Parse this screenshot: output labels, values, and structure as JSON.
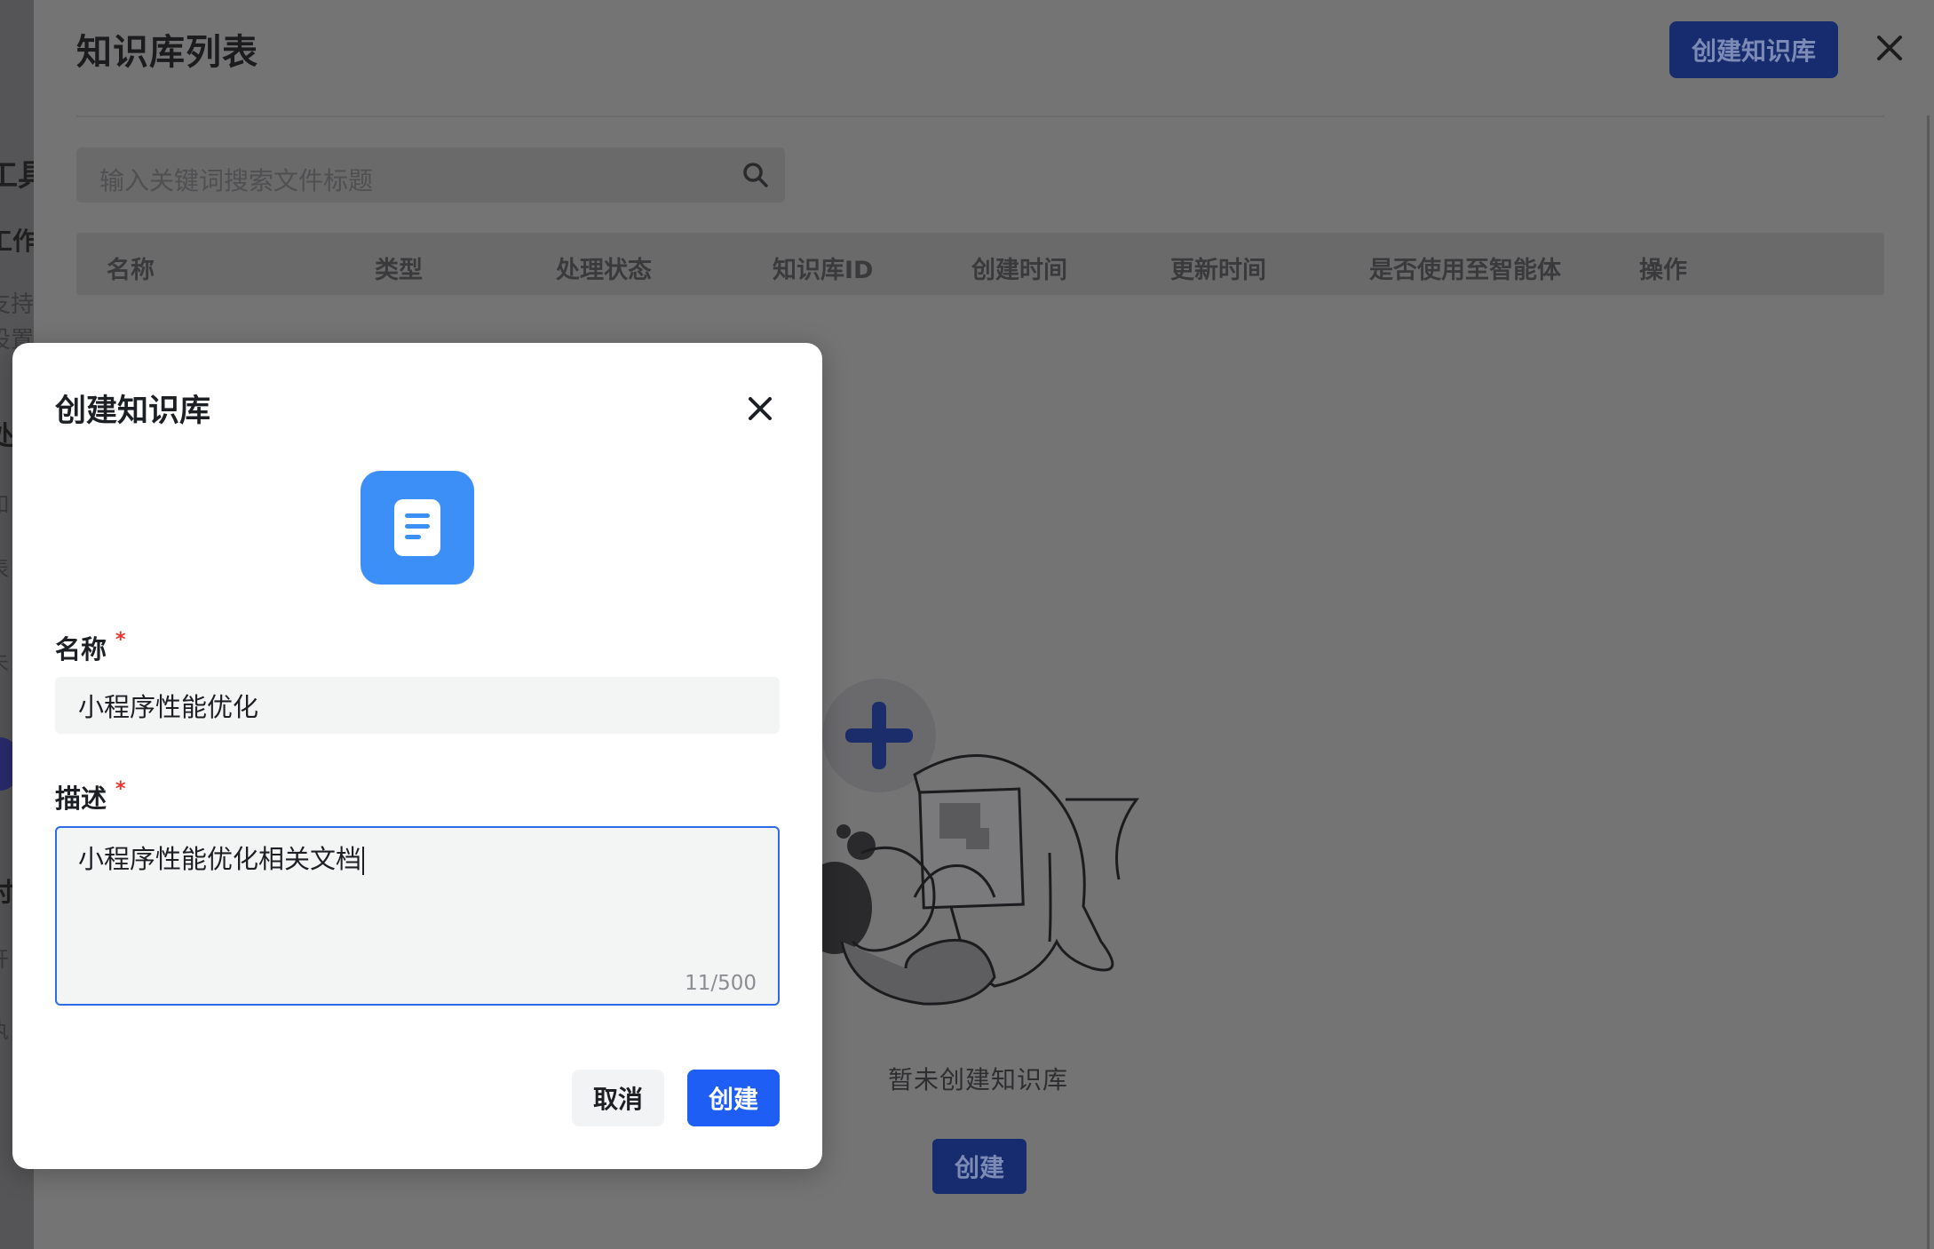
{
  "background": {
    "left_fragments": [
      "工具",
      "工作",
      "支持",
      "设置",
      "处",
      "如",
      "表",
      "未",
      "讨",
      "开",
      "执"
    ],
    "page_title": "知识库列表",
    "create_button": "创建知识库",
    "search": {
      "placeholder": "输入关键词搜索文件标题"
    },
    "table_columns": [
      "名称",
      "类型",
      "处理状态",
      "知识库ID",
      "创建时间",
      "更新时间",
      "是否使用至智能体",
      "操作"
    ],
    "empty_state": {
      "text": "暂未创建知识库",
      "button": "创建"
    }
  },
  "modal": {
    "title": "创建知识库",
    "name_label": "名称",
    "name_value": "小程序性能优化",
    "desc_label": "描述",
    "desc_value": "小程序性能优化相关文档",
    "desc_counter": "11/500",
    "required_mark": "*",
    "cancel_label": "取消",
    "create_label": "创建"
  },
  "colors": {
    "primary": "#1e5ef5",
    "icon_bg": "#3c8ff7",
    "required": "#e8332b",
    "overlay": "#747475"
  }
}
